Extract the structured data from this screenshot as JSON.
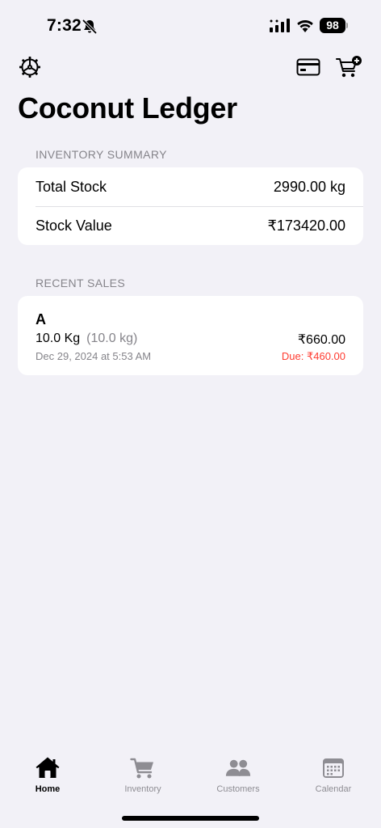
{
  "status_bar": {
    "time": "7:32",
    "battery": "98"
  },
  "title": "Coconut Ledger",
  "inventory_summary": {
    "header": "INVENTORY SUMMARY",
    "rows": [
      {
        "label": "Total Stock",
        "value": "2990.00 kg"
      },
      {
        "label": "Stock Value",
        "value": "₹173420.00"
      }
    ]
  },
  "recent_sales": {
    "header": "RECENT SALES",
    "items": [
      {
        "customer": "A",
        "quantity": "10.0 Kg",
        "quantity_paren": "(10.0 kg)",
        "date": "Dec 29, 2024 at 5:53 AM",
        "amount": "₹660.00",
        "due": "Due: ₹460.00"
      }
    ]
  },
  "tabs": [
    {
      "label": "Home",
      "icon": "house-icon",
      "active": true
    },
    {
      "label": "Inventory",
      "icon": "cart-icon",
      "active": false
    },
    {
      "label": "Customers",
      "icon": "people-icon",
      "active": false
    },
    {
      "label": "Calendar",
      "icon": "calendar-icon",
      "active": false
    }
  ],
  "colors": {
    "background": "#f2f1f7",
    "card": "#ffffff",
    "secondary_text": "#85848a",
    "due_red": "#ff3b30",
    "tab_inactive": "#8e8d93"
  }
}
